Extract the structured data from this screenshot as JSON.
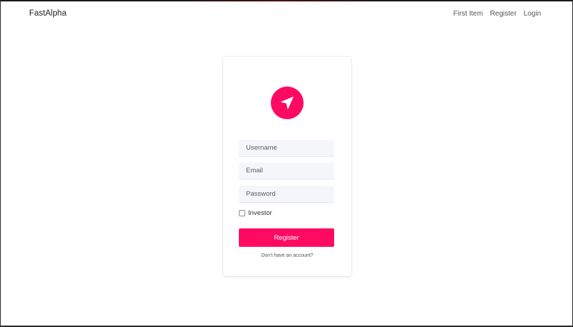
{
  "navbar": {
    "brand": "FastAlpha",
    "links": [
      "First Item",
      "Register",
      "Login"
    ]
  },
  "form": {
    "logo_icon": "navigation-arrow-icon",
    "accent_color": "#ff0a62",
    "username_placeholder": "Username",
    "email_placeholder": "Email",
    "password_placeholder": "Password",
    "investor_label": "Investor",
    "investor_checked": false,
    "submit_label": "Register",
    "footer_text": "Don't have an account?"
  }
}
